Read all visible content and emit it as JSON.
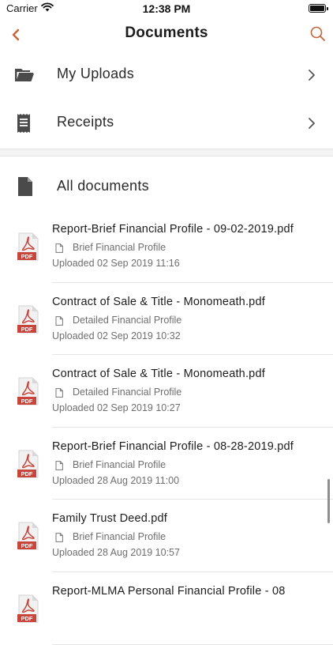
{
  "status_bar": {
    "carrier": "Carrier",
    "time": "12:38 PM"
  },
  "nav": {
    "title": "Documents"
  },
  "menu": [
    {
      "label": "My Uploads",
      "icon": "folder-open-icon"
    },
    {
      "label": "Receipts",
      "icon": "receipt-icon"
    }
  ],
  "section": {
    "label": "All documents",
    "icon": "document-icon"
  },
  "documents": [
    {
      "title": "Report-Brief Financial Profile - 09-02-2019.pdf",
      "category": "Brief Financial Profile",
      "uploaded": "Uploaded 02 Sep 2019 11:16",
      "badge": "PDF"
    },
    {
      "title": "Contract of Sale & Title - Monomeath.pdf",
      "category": "Detailed Financial Profile",
      "uploaded": "Uploaded 02 Sep 2019 10:32",
      "badge": "PDF"
    },
    {
      "title": "Contract of Sale & Title - Monomeath.pdf",
      "category": "Detailed Financial Profile",
      "uploaded": "Uploaded 02 Sep 2019 10:27",
      "badge": "PDF"
    },
    {
      "title": "Report-Brief Financial Profile - 08-28-2019.pdf",
      "category": "Brief Financial Profile",
      "uploaded": "Uploaded 28 Aug 2019 11:00",
      "badge": "PDF"
    },
    {
      "title": "Family Trust Deed.pdf",
      "category": "Brief Financial Profile",
      "uploaded": "Uploaded 28 Aug 2019 10:57",
      "badge": "PDF"
    },
    {
      "title": "Report-MLMA Personal Financial Profile - 08",
      "category": "",
      "uploaded": "",
      "badge": "PDF"
    }
  ],
  "colors": {
    "accent": "#c8643c",
    "pdf_red": "#c8453c",
    "icon_gray": "#4a4a4a",
    "muted_text": "#6e6e6e"
  }
}
